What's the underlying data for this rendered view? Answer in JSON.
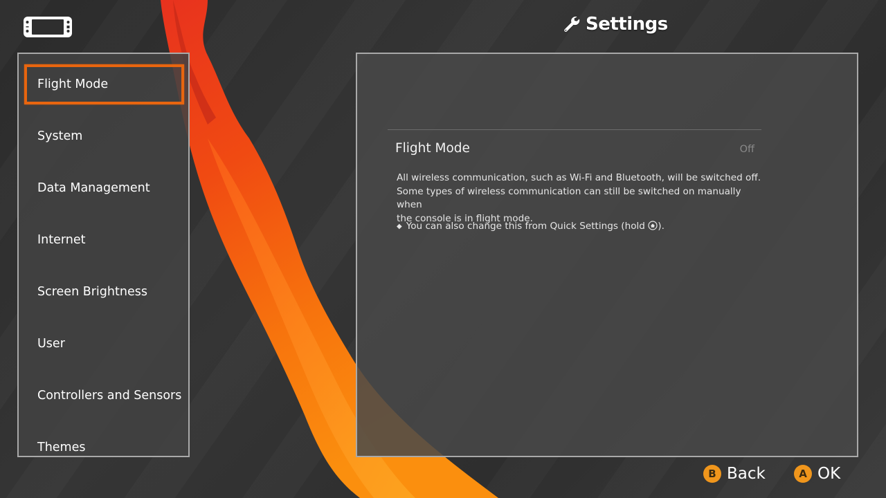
{
  "header": {
    "console_icon": "switch-console-icon",
    "title_icon": "wrench-icon",
    "title": "Settings"
  },
  "sidebar": {
    "items": [
      {
        "label": "Flight Mode",
        "selected": true
      },
      {
        "label": "System"
      },
      {
        "label": "Data Management"
      },
      {
        "label": "Internet"
      },
      {
        "label": "Screen Brightness"
      },
      {
        "label": "User"
      },
      {
        "label": "Controllers and Sensors"
      },
      {
        "label": "Themes"
      }
    ]
  },
  "content": {
    "setting_title": "Flight Mode",
    "setting_value": "Off",
    "description_line1": "All wireless communication, such as Wi-Fi and Bluetooth, will be switched off.",
    "description_line2": "Some types of wireless communication can still be switched on manually when",
    "description_line3": "the console is in flight mode.",
    "note_prefix": "You can also change this from Quick Settings (hold ",
    "note_icon": "home-button-icon",
    "note_suffix": ")."
  },
  "footer": {
    "back_glyph": "B",
    "back_label": "Back",
    "ok_glyph": "A",
    "ok_label": "OK"
  },
  "colors": {
    "accent": "#e8650f",
    "button": "#f0961c",
    "background": "#2f2f2f"
  }
}
